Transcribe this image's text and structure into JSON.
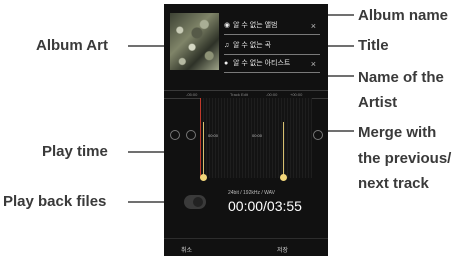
{
  "callouts": {
    "album_name": "Album name",
    "title": "Title",
    "artist_line1": "Name of the",
    "artist_line2": "Artist",
    "merge_line1": "Merge with",
    "merge_line2": "the previous/",
    "merge_line3": "next track",
    "album_art": "Album Art",
    "play_time": "Play time",
    "play_back_files": "Play back files"
  },
  "editor": {
    "album_field": {
      "icon": "disc-icon",
      "value": "알 수 없는 앨범",
      "clear": "×"
    },
    "title_field": {
      "icon": "music-note-icon",
      "value": "알 수 없는 곡",
      "clear": "×"
    },
    "artist_field": {
      "icon": "person-icon",
      "value": "알 수 없는 아티스트",
      "clear": "×"
    },
    "timeline_header": {
      "left": "-05:00",
      "center": "Track Edit",
      "right_a": "-00:00",
      "right_b": "+00:00"
    },
    "start_time": "00:00",
    "end_time": "00:00",
    "format": "24bit / 192kHz / WAV",
    "clock": "00:00/03:55",
    "cancel": "취소",
    "save": "저장"
  }
}
